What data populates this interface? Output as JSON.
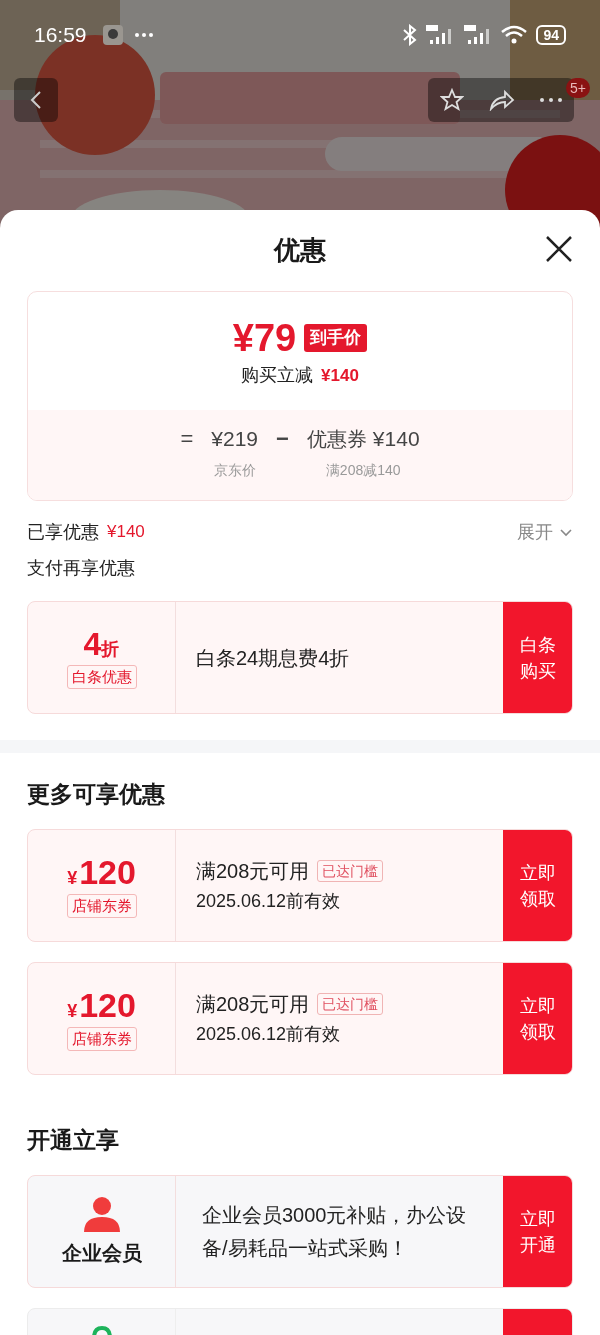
{
  "status_bar": {
    "time": "16:59",
    "battery": "94"
  },
  "top_bar": {
    "badge": "5+"
  },
  "sheet": {
    "title": "优惠"
  },
  "price_summary": {
    "final_price": "¥79",
    "final_tag": "到手价",
    "instant_label": "购买立减",
    "instant_amount": "¥140",
    "equals": "=",
    "base_price": "¥219",
    "base_label": "京东价",
    "minus": "−",
    "coupon_label": "优惠券",
    "coupon_amount": "¥140",
    "coupon_rule": "满208减140"
  },
  "enjoyed": {
    "label": "已享优惠",
    "amount": "¥140",
    "toggle": "展开",
    "expanded": false
  },
  "pay_section": {
    "title": "支付再享优惠"
  },
  "pay_offers": [
    {
      "value": "4",
      "unit": "折",
      "tag": "白条优惠",
      "text": "白条24期息费4折",
      "button": "白条购买"
    }
  ],
  "more_section": {
    "title": "更多可享优惠"
  },
  "coupons": [
    {
      "currency": "¥",
      "amount": "120",
      "tag": "店铺东券",
      "condition": "满208元可用",
      "badge": "已达门槛",
      "validity": "2025.06.12前有效",
      "button": "立即领取"
    },
    {
      "currency": "¥",
      "amount": "120",
      "tag": "店铺东券",
      "condition": "满208元可用",
      "badge": "已达门槛",
      "validity": "2025.06.12前有效",
      "button": "立即领取"
    }
  ],
  "join_section": {
    "title": "开通立享"
  },
  "memberships": [
    {
      "kind": "full",
      "color": "#f03c3c",
      "name": "企业会员",
      "text": "企业会员3000元补贴，办公设备/易耗品一站式采购！",
      "button": "立即开通"
    },
    {
      "kind": "partial",
      "color": "#1db35b"
    }
  ]
}
